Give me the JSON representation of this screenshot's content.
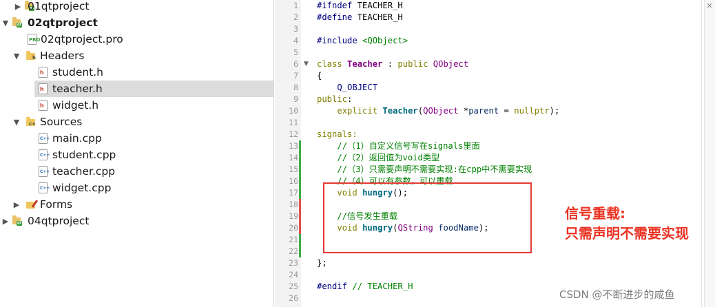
{
  "tree": {
    "items": [
      {
        "label": "01qtproject",
        "bold": false,
        "arrow": "▶",
        "kind": "project"
      },
      {
        "label": "02qtproject",
        "bold": true,
        "arrow": "▼",
        "kind": "project"
      },
      {
        "label": "02qtproject.pro",
        "kind": "pro",
        "tag": "PRO"
      },
      {
        "label": "Headers",
        "arrow": "▼",
        "kind": "folder",
        "tag": "h"
      },
      {
        "label": "student.h",
        "kind": "h",
        "tag": "h"
      },
      {
        "label": "teacher.h",
        "kind": "h",
        "tag": "h",
        "selected": true
      },
      {
        "label": "widget.h",
        "kind": "h",
        "tag": "h"
      },
      {
        "label": "Sources",
        "arrow": "▼",
        "kind": "folder",
        "tag": "c+"
      },
      {
        "label": "main.cpp",
        "kind": "cpp",
        "tag": "C++"
      },
      {
        "label": "student.cpp",
        "kind": "cpp",
        "tag": "C++"
      },
      {
        "label": "teacher.cpp",
        "kind": "cpp",
        "tag": "C++"
      },
      {
        "label": "widget.cpp",
        "kind": "cpp",
        "tag": "C++"
      },
      {
        "label": "Forms",
        "arrow": "▶",
        "kind": "forms"
      },
      {
        "label": "04qtproject",
        "arrow": "▶",
        "kind": "project"
      }
    ]
  },
  "editor": {
    "line_numbers": [
      "1",
      "2",
      "3",
      "4",
      "5",
      "6",
      "7",
      "8",
      "9",
      "10",
      "11",
      "12",
      "13",
      "14",
      "15",
      "16",
      "17",
      "18",
      "19",
      "20",
      "21",
      "22",
      "23",
      "24",
      "25",
      "26"
    ],
    "fold_marker": "▼",
    "close_icon": "✕",
    "lines": {
      "l1a": "#ifndef",
      "l1b": " TEACHER_H",
      "l2a": "#define",
      "l2b": " TEACHER_H",
      "l4a": "#include",
      "l4b": " <QObject>",
      "l6a": "class",
      "l6b": "Teacher",
      "l6c": " : ",
      "l6d": "public",
      "l6e": " QObject",
      "l7": "{",
      "l8": "Q_OBJECT",
      "l9a": "public",
      "l9b": ":",
      "l10a": "explicit",
      "l10b": "Teacher",
      "l10c": "(",
      "l10d": "QObject",
      "l10e": " *",
      "l10f": "parent",
      "l10g": " = ",
      "l10h": "nullptr",
      "l10i": ");",
      "l12": "signals:",
      "l13": "//（1）自定义信号写在signals里面",
      "l14": "//（2）返回值为void类型",
      "l15": "//（3）只需要声明不需要实现:在cpp中不需要实现",
      "l16": "//（4）可以有参数，可以重载",
      "l17a": "void",
      "l17b": "hungry",
      "l17c": "();",
      "l19": "//信号发生重载",
      "l20a": "void",
      "l20b": "hungry",
      "l20c": "(",
      "l20d": "QString",
      "l20e": "foodName",
      "l20f": ");",
      "l23": "};",
      "l25a": "#endif",
      "l25b": " // TEACHER_H"
    }
  },
  "annotation": {
    "line1": "信号重载:",
    "line2": "只需声明不需要实现"
  },
  "watermark": "CSDN @不断进步的咸鱼",
  "colors": {
    "change_green": "#3fae49",
    "change_red": "#e05050",
    "box_red": "#e53935"
  }
}
